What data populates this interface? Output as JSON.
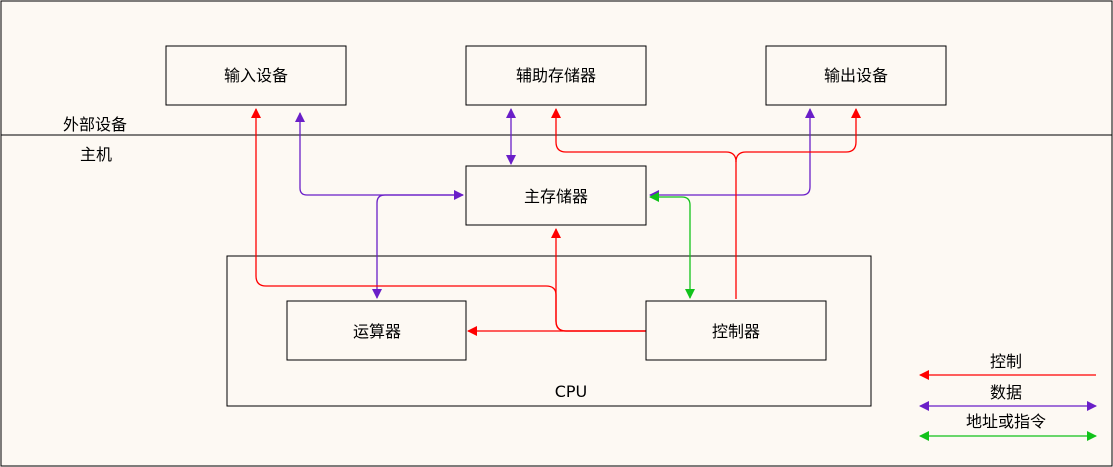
{
  "regions": {
    "external_label": "外部设备",
    "host_label": "主机",
    "cpu_label": "CPU"
  },
  "nodes": {
    "input_device": "输入设备",
    "aux_storage": "辅助存储器",
    "output_device": "输出设备",
    "main_memory": "主存储器",
    "alu": "运算器",
    "controller": "控制器"
  },
  "legend": {
    "control": "控制",
    "data": "数据",
    "address": "地址或指令"
  },
  "colors": {
    "control": "#ff0000",
    "data": "#6a1fc8",
    "address": "#11c21a",
    "background": "#fdf9f3",
    "stroke": "#000000"
  }
}
